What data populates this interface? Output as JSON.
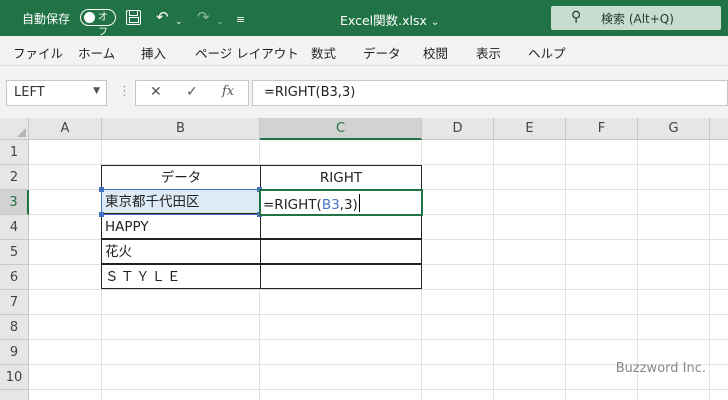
{
  "titlebar": {
    "autosave_label": "自動保存",
    "autosave_state": "オフ",
    "doc_title": "Excel関数.xlsx",
    "doc_title_arrow": "⌄",
    "search_placeholder": "検索 (Alt+Q)",
    "icons": [
      "save-icon",
      "undo-icon",
      "redo-icon",
      "customize-qat-icon",
      "search-icon"
    ]
  },
  "ribbon": {
    "tabs": [
      "ファイル",
      "ホーム",
      "挿入",
      "ページ レイアウト",
      "数式",
      "データ",
      "校閲",
      "表示",
      "ヘルプ"
    ]
  },
  "formula_bar": {
    "name_box": "LEFT",
    "formula": "=RIGHT(B3,3)",
    "buttons": [
      "cancel-icon",
      "enter-icon",
      "insert-function-icon"
    ]
  },
  "grid": {
    "columns": [
      "A",
      "B",
      "C",
      "D",
      "E",
      "F",
      "G"
    ],
    "rows": [
      "1",
      "2",
      "3",
      "4",
      "5",
      "6",
      "7",
      "8",
      "9",
      "10"
    ],
    "active_cell": "C3",
    "table": {
      "headers": [
        "データ",
        "RIGHT"
      ],
      "rows": [
        {
          "b": "東京都千代田区",
          "c_prefix": "=RIGHT(",
          "c_ref": "B3",
          "c_suffix": ",3)"
        },
        {
          "b": "HAPPY",
          "c": ""
        },
        {
          "b": "花火",
          "c": ""
        },
        {
          "b": "ＳＴＹＬＥ",
          "c": ""
        }
      ]
    }
  },
  "watermark": "Buzzword Inc.",
  "colors": {
    "excel_green": "#217346",
    "reference_blue": "#4472c4",
    "reference_fill": "#ddebf7"
  }
}
